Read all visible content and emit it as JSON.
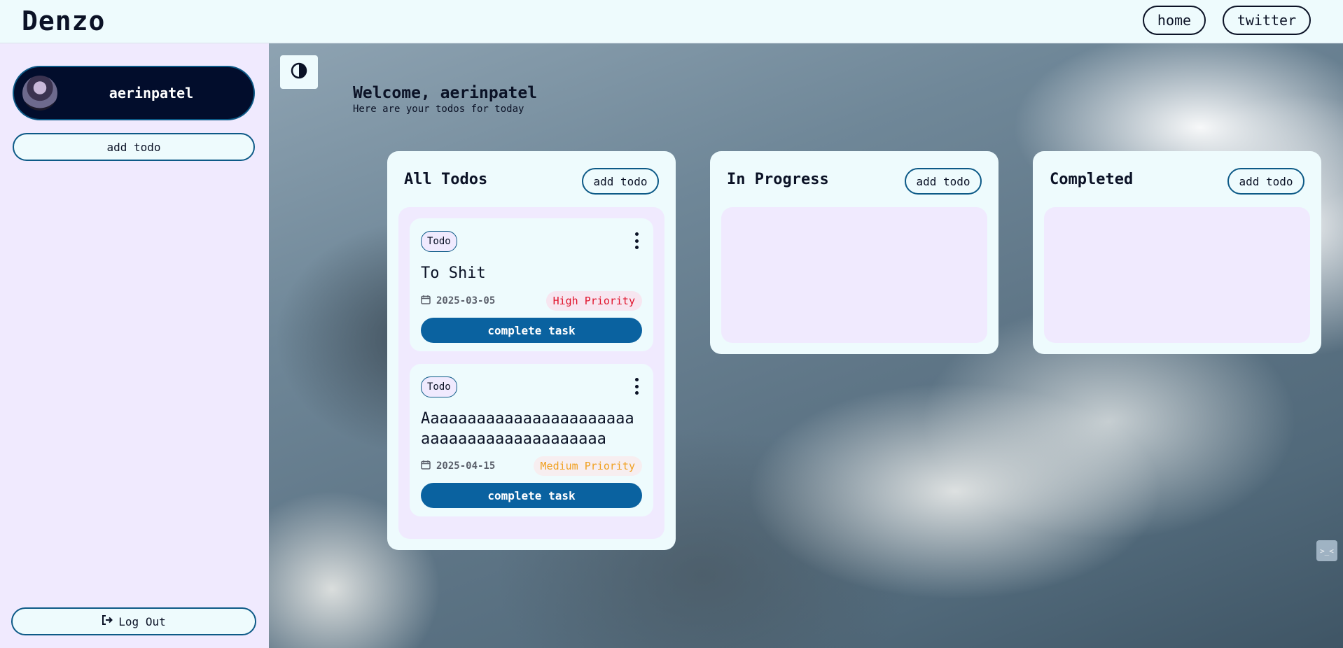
{
  "header": {
    "brand": "Denzo",
    "nav": {
      "home": "home",
      "twitter": "twitter"
    }
  },
  "sidebar": {
    "username": "aerinpatel",
    "add_todo": "add todo",
    "logout": "Log Out"
  },
  "main": {
    "welcome_title": "Welcome, aerinpatel",
    "welcome_subtitle": "Here are your todos for today",
    "columns": [
      {
        "title": "All Todos",
        "add_label": "add todo",
        "todos": [
          {
            "tag": "Todo",
            "title": "To Shit",
            "date": "2025-03-05",
            "priority": "High Priority",
            "action": "complete task"
          },
          {
            "tag": "Todo",
            "title": "Aaaaaaaaaaaaaaaaaaaaaaaaaaaaaaaaaaaaaaaaaaa",
            "date": "2025-04-15",
            "priority": "Medium Priority",
            "action": "complete task"
          }
        ]
      },
      {
        "title": "In Progress",
        "add_label": "add todo",
        "todos": []
      },
      {
        "title": "Completed",
        "add_label": "add todo",
        "todos": []
      }
    ]
  },
  "icons": {
    "theme_toggle": "contrast-icon",
    "calendar": "calendar-icon",
    "more": "kebab-menu-icon",
    "logout": "logout-icon"
  },
  "colors": {
    "accent": "#0a62a0",
    "high_priority": "#e0142c",
    "medium_priority": "#f0a020",
    "profile_bg": "#020d2c",
    "sidebar_bg": "#f0eafe",
    "card_bg": "#eefbfd"
  }
}
